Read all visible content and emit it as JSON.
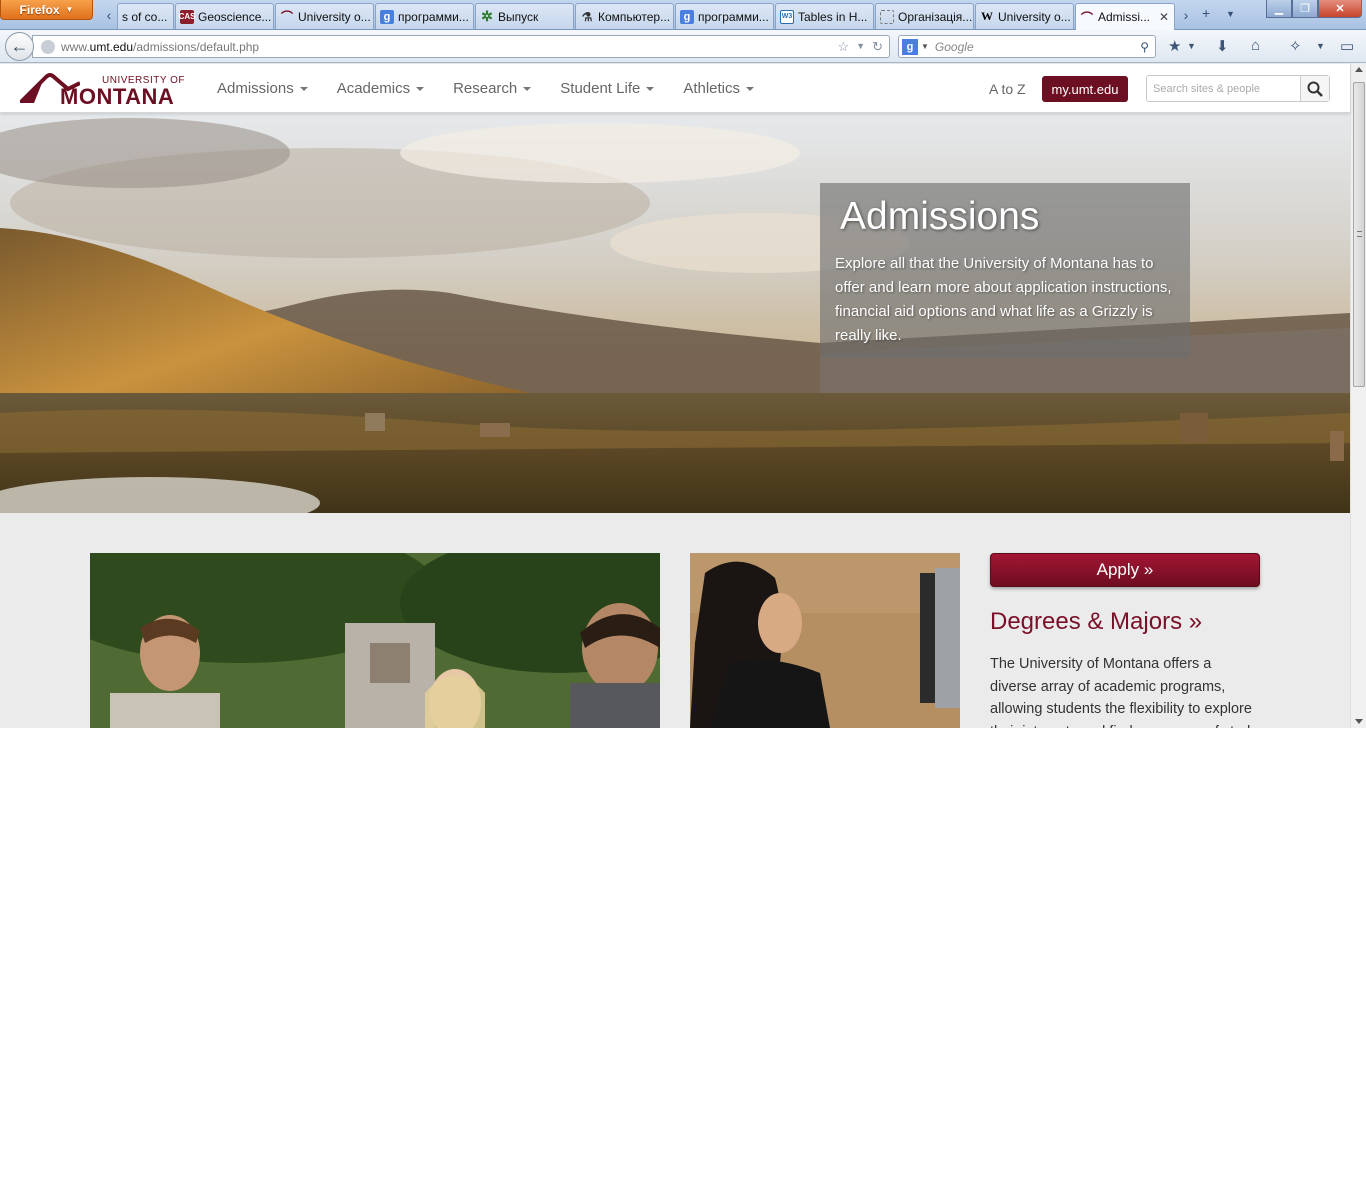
{
  "browser": {
    "menu_label": "Firefox",
    "tabs": [
      {
        "label": "s of co...",
        "icon": "none"
      },
      {
        "label": "Geoscience...",
        "icon": "cas-icon"
      },
      {
        "label": "University o...",
        "icon": "umt-icon"
      },
      {
        "label": "программи...",
        "icon": "google-icon"
      },
      {
        "label": "Выпуск",
        "icon": "tree-icon"
      },
      {
        "label": "Компьютер...",
        "icon": "flask-icon"
      },
      {
        "label": "программи...",
        "icon": "google-icon"
      },
      {
        "label": "Tables in H...",
        "icon": "w3-icon"
      },
      {
        "label": "Організація...",
        "icon": "dashed-icon"
      },
      {
        "label": "University o...",
        "icon": "wikipedia-icon"
      },
      {
        "label": "Admissi...",
        "icon": "umt-icon",
        "active": true
      }
    ],
    "url_prefix": "www.",
    "url_host": "umt.edu",
    "url_path": "/admissions/default.php",
    "search_engine_placeholder": "Google"
  },
  "site": {
    "logo_small": "UNIVERSITY OF",
    "logo_big": "MONTANA",
    "nav": [
      "Admissions",
      "Academics",
      "Research",
      "Student Life",
      "Athletics"
    ],
    "atoz": "A to Z",
    "my_button": "my.umt.edu",
    "search_placeholder": "Search sites & people"
  },
  "hero": {
    "title": "Admissions",
    "text": "Explore all that the University of Montana has to offer and learn more about application instructions, financial aid options and what life as a Grizzly is really like."
  },
  "sidebar": {
    "apply_label": "Apply »",
    "degrees_title": "Degrees & Majors »",
    "degrees_text": "The University of Montana offers a diverse array of academic programs, allowing students the flexibility to explore their interests and find a program of study"
  },
  "colors": {
    "brand": "#6d0f22",
    "apply_button": "#8c1230",
    "firefox_orange": "#e8801f"
  }
}
